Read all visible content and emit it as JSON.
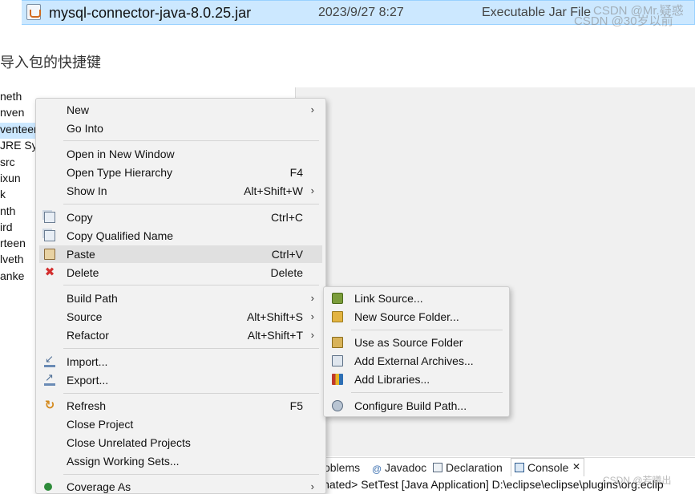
{
  "file_row": {
    "name": "mysql-connector-java-8.0.25.jar",
    "date": "2023/9/27 8:27",
    "type": "Executable Jar File"
  },
  "watermarks": [
    "CSDN @Mr.疑惑",
    "CSDN @30岁以前",
    "CSDN @若曦出"
  ],
  "heading": "导入包的快捷键",
  "tree_items": [
    {
      "label": "neth",
      "selected": false
    },
    {
      "label": "nven",
      "selected": false
    },
    {
      "label": "venteen",
      "selected": true
    },
    {
      "label": "JRE Sy",
      "selected": false
    },
    {
      "label": "src",
      "selected": false
    },
    {
      "label": "ixun",
      "selected": false
    },
    {
      "label": "k",
      "selected": false
    },
    {
      "label": "nth",
      "selected": false
    },
    {
      "label": "ird",
      "selected": false
    },
    {
      "label": "rteen",
      "selected": false
    },
    {
      "label": "lveth",
      "selected": false
    },
    {
      "label": "anke",
      "selected": false
    }
  ],
  "context_menu": {
    "items": [
      {
        "label": "New",
        "accel": "",
        "submenu": true
      },
      {
        "label": "Go Into",
        "accel": "",
        "submenu": false
      },
      {
        "label": "Open in New Window",
        "accel": "",
        "submenu": false
      },
      {
        "label": "Open Type Hierarchy",
        "accel": "F4",
        "submenu": false
      },
      {
        "label": "Show In",
        "accel": "Alt+Shift+W",
        "submenu": true
      },
      {
        "label": "Copy",
        "accel": "Ctrl+C",
        "submenu": false
      },
      {
        "label": "Copy Qualified Name",
        "accel": "",
        "submenu": false
      },
      {
        "label": "Paste",
        "accel": "Ctrl+V",
        "submenu": false
      },
      {
        "label": "Delete",
        "accel": "Delete",
        "submenu": false
      },
      {
        "label": "Build Path",
        "accel": "",
        "submenu": true
      },
      {
        "label": "Source",
        "accel": "Alt+Shift+S",
        "submenu": true
      },
      {
        "label": "Refactor",
        "accel": "Alt+Shift+T",
        "submenu": true
      },
      {
        "label": "Import...",
        "accel": "",
        "submenu": false
      },
      {
        "label": "Export...",
        "accel": "",
        "submenu": false
      },
      {
        "label": "Refresh",
        "accel": "F5",
        "submenu": false
      },
      {
        "label": "Close Project",
        "accel": "",
        "submenu": false
      },
      {
        "label": "Close Unrelated Projects",
        "accel": "",
        "submenu": false
      },
      {
        "label": "Assign Working Sets...",
        "accel": "",
        "submenu": false
      },
      {
        "label": "Coverage As",
        "accel": "",
        "submenu": true
      }
    ]
  },
  "build_path_submenu": {
    "items": [
      {
        "label": "Link Source..."
      },
      {
        "label": "New Source Folder..."
      },
      {
        "label": "Use as Source Folder"
      },
      {
        "label": "Add External Archives..."
      },
      {
        "label": "Add Libraries..."
      },
      {
        "label": "Configure Build Path..."
      }
    ]
  },
  "views": {
    "tabs": [
      {
        "label": "oblems"
      },
      {
        "label": "Javadoc"
      },
      {
        "label": "Declaration"
      },
      {
        "label": "Console"
      }
    ],
    "close_glyph": "✕",
    "console_text": "inated> SetTest [Java Application] D:\\eclipse\\eclipse\\plugins\\org.eclip"
  },
  "colors": {
    "selection": "#cce8ff",
    "menu_bg": "#f2f2f2",
    "menu_hover": "#e0e0e0"
  },
  "icons": {
    "submenu_arrow": "›",
    "delete": "✖",
    "refresh": "↻"
  }
}
